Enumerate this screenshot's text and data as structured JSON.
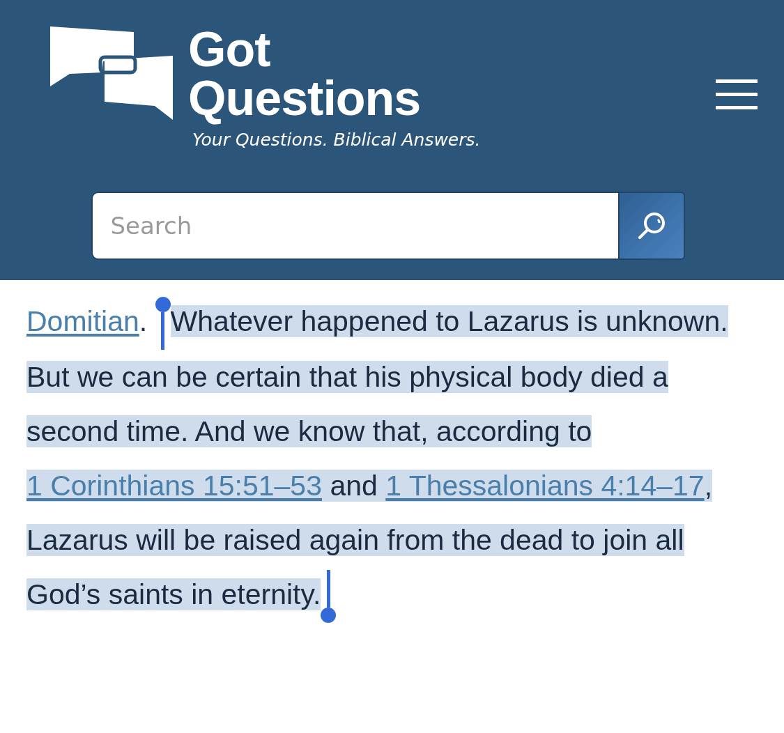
{
  "header": {
    "logo": {
      "line_1": "Got",
      "line_2": "Questions",
      "tagline": "Your Questions. Biblical Answers."
    },
    "search": {
      "placeholder": "Search"
    }
  },
  "paragraph": [
    {
      "kind": "link",
      "text": "Domitian",
      "selected": false
    },
    {
      "kind": "text",
      "text": ". ",
      "selected": false
    },
    {
      "kind": "text",
      "text": "Whatever happened to Lazarus is unknown. But we can be certain that his physical body died a second time. And we know that, according to ",
      "selected": true
    },
    {
      "kind": "link",
      "text": "1 Corinthians 15:51–53",
      "selected": true
    },
    {
      "kind": "text",
      "text": " and ",
      "selected": true
    },
    {
      "kind": "link",
      "text": "1 Thessalonians 4:14–17",
      "selected": true
    },
    {
      "kind": "text",
      "text": ", Lazarus will be raised again from the dead to join all God’s saints in eternity.",
      "selected": true
    }
  ]
}
